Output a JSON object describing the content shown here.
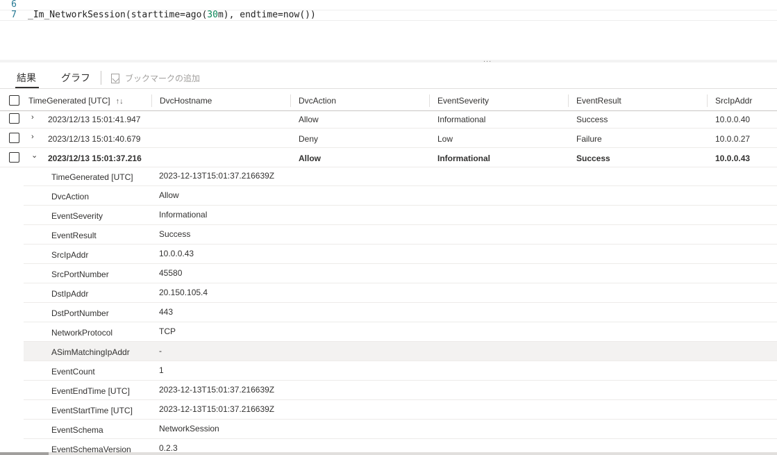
{
  "editor": {
    "lines": [
      {
        "num": "6",
        "code_pre": "",
        "code_num": "",
        "code_post": ""
      },
      {
        "num": "7",
        "code_pre": "_Im_NetworkSession(starttime=ago(",
        "code_num": "30",
        "code_post": "m), endtime=now())"
      }
    ],
    "splitter_grip": "..."
  },
  "tabs": {
    "results_label": "結果",
    "chart_label": "グラフ",
    "bookmark_label": "ブックマークの追加"
  },
  "grid": {
    "columns": [
      "TimeGenerated [UTC]",
      "DvcHostname",
      "DvcAction",
      "EventSeverity",
      "EventResult",
      "SrcIpAddr"
    ],
    "sort_indicator": "↑↓",
    "rows": [
      {
        "time": "2023/12/13 15:01:41.947",
        "host": "",
        "action": "Allow",
        "severity": "Informational",
        "result": "Success",
        "src": "10.0.0.40",
        "chevron": "›",
        "expanded": false
      },
      {
        "time": "2023/12/13 15:01:40.679",
        "host": "",
        "action": "Deny",
        "severity": "Low",
        "result": "Failure",
        "src": "10.0.0.27",
        "chevron": "›",
        "expanded": false
      },
      {
        "time": "2023/12/13 15:01:37.216",
        "host": "",
        "action": "Allow",
        "severity": "Informational",
        "result": "Success",
        "src": "10.0.0.43",
        "chevron": "⌄",
        "expanded": true
      }
    ]
  },
  "detail": [
    {
      "key": "TimeGenerated [UTC]",
      "value": "2023-12-13T15:01:37.216639Z"
    },
    {
      "key": "DvcAction",
      "value": "Allow"
    },
    {
      "key": "EventSeverity",
      "value": "Informational"
    },
    {
      "key": "EventResult",
      "value": "Success"
    },
    {
      "key": "SrcIpAddr",
      "value": "10.0.0.43"
    },
    {
      "key": "SrcPortNumber",
      "value": "45580"
    },
    {
      "key": "DstIpAddr",
      "value": "20.150.105.4"
    },
    {
      "key": "DstPortNumber",
      "value": "443"
    },
    {
      "key": "NetworkProtocol",
      "value": "TCP"
    },
    {
      "key": "ASimMatchingIpAddr",
      "value": "-"
    },
    {
      "key": "EventCount",
      "value": "1"
    },
    {
      "key": "EventEndTime [UTC]",
      "value": "2023-12-13T15:01:37.216639Z"
    },
    {
      "key": "EventStartTime [UTC]",
      "value": "2023-12-13T15:01:37.216639Z"
    },
    {
      "key": "EventSchema",
      "value": "NetworkSession"
    },
    {
      "key": "EventSchemaVersion",
      "value": "0.2.3"
    }
  ]
}
